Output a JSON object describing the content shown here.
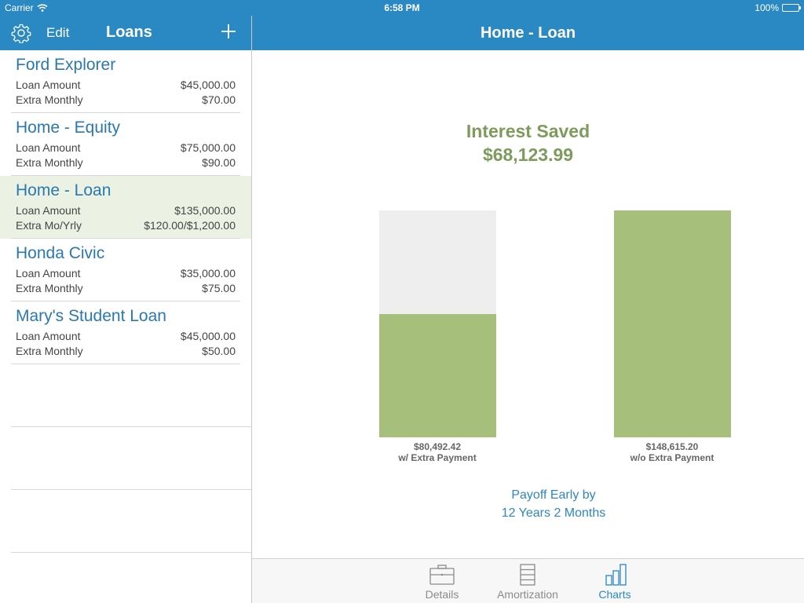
{
  "status_bar": {
    "carrier": "Carrier",
    "time": "6:58 PM",
    "battery": "100%"
  },
  "sidebar": {
    "edit_label": "Edit",
    "title": "Loans",
    "add_icon": "plus-icon",
    "settings_icon": "gear-icon",
    "loans": [
      {
        "name": "Ford Explorer",
        "label1": "Loan Amount",
        "value1": "$45,000.00",
        "label2": "Extra Monthly",
        "value2": "$70.00",
        "selected": false
      },
      {
        "name": "Home - Equity",
        "label1": "Loan Amount",
        "value1": "$75,000.00",
        "label2": "Extra Monthly",
        "value2": "$90.00",
        "selected": false
      },
      {
        "name": "Home - Loan",
        "label1": "Loan Amount",
        "value1": "$135,000.00",
        "label2": "Extra Mo/Yrly",
        "value2": "$120.00/$1,200.00",
        "selected": true
      },
      {
        "name": "Honda Civic",
        "label1": "Loan Amount",
        "value1": "$35,000.00",
        "label2": "Extra Monthly",
        "value2": "$75.00",
        "selected": false
      },
      {
        "name": "Mary's Student Loan",
        "label1": "Loan Amount",
        "value1": "$45,000.00",
        "label2": "Extra Monthly",
        "value2": "$50.00",
        "selected": false
      }
    ]
  },
  "detail": {
    "title": "Home - Loan",
    "interest_saved_label": "Interest Saved",
    "interest_saved_value": "$68,123.99",
    "payoff_line1": "Payoff Early by",
    "payoff_line2": "12 Years 2 Months"
  },
  "chart_data": {
    "type": "bar",
    "categories": [
      "w/ Extra Payment",
      "w/o Extra Payment"
    ],
    "values": [
      80492.42,
      148615.2
    ],
    "value_labels": [
      "$80,492.42",
      "$148,615.20"
    ],
    "ylim": [
      0,
      148615.2
    ],
    "grid": false,
    "colors": {
      "fill": "#a6c07c",
      "track": "#eeeeee"
    }
  },
  "tabs": [
    {
      "label": "Details",
      "icon": "briefcase-icon",
      "active": false
    },
    {
      "label": "Amortization",
      "icon": "list-icon",
      "active": false
    },
    {
      "label": "Charts",
      "icon": "bar-chart-icon",
      "active": true
    }
  ],
  "colors": {
    "nav": "#2a88c2",
    "accent_green": "#7d9b5a",
    "selected_row": "#ebf2e4",
    "link_blue": "#2a78b0"
  }
}
